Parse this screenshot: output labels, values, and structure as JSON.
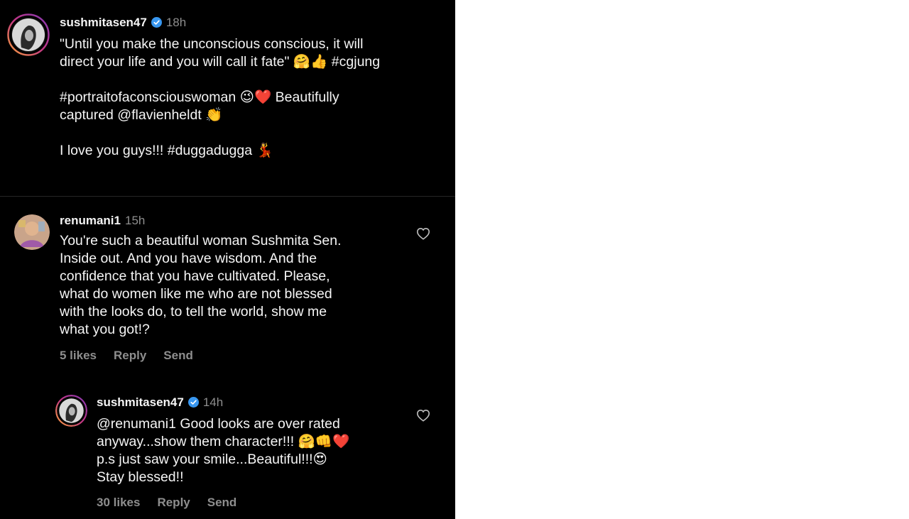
{
  "post": {
    "username": "sushmitasen47",
    "time": "18h",
    "lines": [
      "\"Until you make the unconscious conscious, it will",
      "direct your life and you will call it fate\" 🤗👍 #cgjung",
      "",
      "#portraitofaconsciouswoman 😉❤️ Beautifully",
      "captured @flavienheldt 👏",
      "",
      "I love you guys!!! #duggadugga 💃"
    ]
  },
  "comments": [
    {
      "username": "renumani1",
      "time": "15h",
      "lines": [
        "You're such a beautiful woman Sushmita Sen.",
        "Inside out. And you have wisdom. And the",
        "confidence that you have cultivated. Please,",
        "what do women like me who are not blessed",
        "with the looks do, to tell the world, show me",
        "what you got!?"
      ],
      "likes": "5 likes",
      "reply": "Reply",
      "send": "Send"
    },
    {
      "username": "sushmitasen47",
      "time": "14h",
      "lines": [
        "@renumani1 Good looks are over rated",
        "anyway...show them character!!! 🤗👊❤️",
        "p.s just saw your smile...Beautiful!!!😍",
        "Stay blessed!!"
      ],
      "likes": "30 likes",
      "reply": "Reply",
      "send": "Send"
    }
  ],
  "icons": {
    "verified": "verified-badge-icon",
    "heart": "heart-outline-icon"
  },
  "colors": {
    "background": "#000000",
    "text": "#f5f5f5",
    "muted": "#8e8e8e",
    "verified": "#3897f0",
    "story_ring": "#c13584"
  }
}
